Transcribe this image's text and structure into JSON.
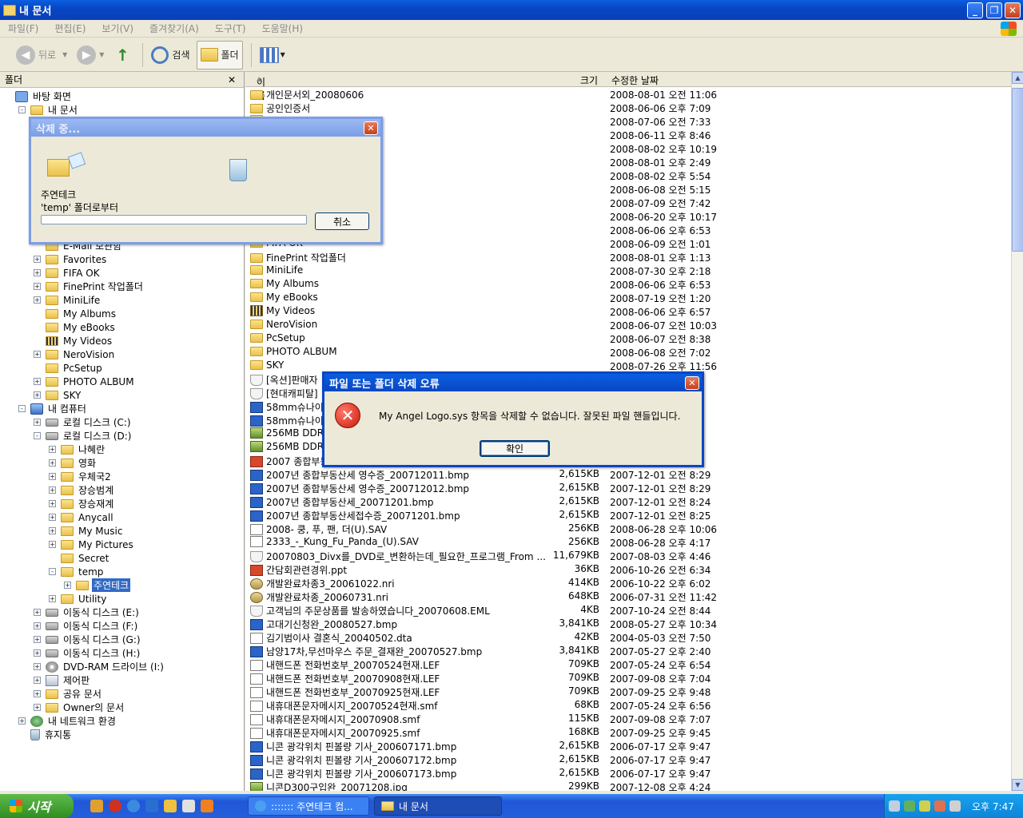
{
  "window": {
    "title": "내 문서"
  },
  "menu": [
    "파일(F)",
    "편집(E)",
    "보기(V)",
    "즐겨찾기(A)",
    "도구(T)",
    "도움말(H)"
  ],
  "toolbar": {
    "back": "뒤로",
    "search": "검색",
    "folders": "폴더"
  },
  "folder_pane": {
    "title": "폴더",
    "close": "✕"
  },
  "tree": [
    {
      "label": "바탕 화면",
      "level": 0,
      "exp": "",
      "icon": "desk"
    },
    {
      "label": "내 문서",
      "level": 1,
      "exp": "-",
      "icon": "mydocs"
    },
    {
      "label": "",
      "level": 2,
      "exp": "+",
      "icon": "folder"
    },
    {
      "label": "",
      "level": 2,
      "exp": "+",
      "icon": "folder"
    },
    {
      "label": "",
      "level": 2,
      "exp": "+",
      "icon": "folder"
    },
    {
      "label": "",
      "level": 2,
      "exp": "",
      "icon": "folder"
    },
    {
      "label": "",
      "level": 2,
      "exp": "+",
      "icon": "folder"
    },
    {
      "label": "",
      "level": 2,
      "exp": "+",
      "icon": "folder"
    },
    {
      "label": "",
      "level": 2,
      "exp": "",
      "icon": "folder"
    },
    {
      "label": "",
      "level": 2,
      "exp": "+",
      "icon": "folder"
    },
    {
      "label": "",
      "level": 2,
      "exp": "",
      "icon": "folder"
    },
    {
      "label": "E-Mail 보관함",
      "level": 2,
      "exp": "",
      "icon": "folder"
    },
    {
      "label": "Favorites",
      "level": 2,
      "exp": "+",
      "icon": "folder"
    },
    {
      "label": "FIFA OK",
      "level": 2,
      "exp": "+",
      "icon": "folder"
    },
    {
      "label": "FinePrint 작업폴더",
      "level": 2,
      "exp": "+",
      "icon": "folder"
    },
    {
      "label": "MiniLife",
      "level": 2,
      "exp": "+",
      "icon": "folder"
    },
    {
      "label": "My Albums",
      "level": 2,
      "exp": "",
      "icon": "folder"
    },
    {
      "label": "My eBooks",
      "level": 2,
      "exp": "",
      "icon": "folder"
    },
    {
      "label": "My Videos",
      "level": 2,
      "exp": "",
      "icon": "video"
    },
    {
      "label": "NeroVision",
      "level": 2,
      "exp": "+",
      "icon": "folder"
    },
    {
      "label": "PcSetup",
      "level": 2,
      "exp": "",
      "icon": "folder"
    },
    {
      "label": "PHOTO ALBUM",
      "level": 2,
      "exp": "+",
      "icon": "folder"
    },
    {
      "label": "SKY",
      "level": 2,
      "exp": "+",
      "icon": "folder"
    },
    {
      "label": "내 컴퓨터",
      "level": 1,
      "exp": "-",
      "icon": "pc"
    },
    {
      "label": "로컬 디스크 (C:)",
      "level": 2,
      "exp": "+",
      "icon": "drive"
    },
    {
      "label": "로컬 디스크 (D:)",
      "level": 2,
      "exp": "-",
      "icon": "drive"
    },
    {
      "label": "나혜란",
      "level": 3,
      "exp": "+",
      "icon": "folder"
    },
    {
      "label": "영화",
      "level": 3,
      "exp": "+",
      "icon": "folder"
    },
    {
      "label": "우체국2",
      "level": 3,
      "exp": "+",
      "icon": "folder"
    },
    {
      "label": "장승범계",
      "level": 3,
      "exp": "+",
      "icon": "folder"
    },
    {
      "label": "장승재계",
      "level": 3,
      "exp": "+",
      "icon": "folder"
    },
    {
      "label": "Anycall",
      "level": 3,
      "exp": "+",
      "icon": "folder"
    },
    {
      "label": "My Music",
      "level": 3,
      "exp": "+",
      "icon": "folder"
    },
    {
      "label": "My Pictures",
      "level": 3,
      "exp": "+",
      "icon": "folder"
    },
    {
      "label": "Secret",
      "level": 3,
      "exp": "",
      "icon": "folder"
    },
    {
      "label": "temp",
      "level": 3,
      "exp": "-",
      "icon": "folder"
    },
    {
      "label": "주연테크",
      "level": 4,
      "exp": "+",
      "icon": "folder",
      "selected": true
    },
    {
      "label": "Utility",
      "level": 3,
      "exp": "+",
      "icon": "folder"
    },
    {
      "label": "이동식 디스크 (E:)",
      "level": 2,
      "exp": "+",
      "icon": "drive"
    },
    {
      "label": "이동식 디스크 (F:)",
      "level": 2,
      "exp": "+",
      "icon": "drive"
    },
    {
      "label": "이동식 디스크 (G:)",
      "level": 2,
      "exp": "+",
      "icon": "drive"
    },
    {
      "label": "이동식 디스크 (H:)",
      "level": 2,
      "exp": "+",
      "icon": "drive"
    },
    {
      "label": "DVD-RAM 드라이브 (I:)",
      "level": 2,
      "exp": "+",
      "icon": "dvd"
    },
    {
      "label": "제어판",
      "level": 2,
      "exp": "+",
      "icon": "ctrl"
    },
    {
      "label": "공유 문서",
      "level": 2,
      "exp": "+",
      "icon": "folder"
    },
    {
      "label": "Owner의 문서",
      "level": 2,
      "exp": "+",
      "icon": "folder"
    },
    {
      "label": "내 네트워크 환경",
      "level": 1,
      "exp": "+",
      "icon": "net"
    },
    {
      "label": "휴지통",
      "level": 1,
      "exp": "",
      "icon": "bin"
    }
  ],
  "list_headers": {
    "name": "이름",
    "size": "크기",
    "date": "수정한 날짜"
  },
  "files": [
    {
      "name": "개인문서외_20080606",
      "size": "",
      "date": "2008-08-01 오전 11:06",
      "icon": "folder"
    },
    {
      "name": "공인인증서",
      "size": "",
      "date": "2008-06-06 오후 7:09",
      "icon": "folder"
    },
    {
      "name": "",
      "size": "",
      "date": "2008-07-06 오전 7:33",
      "icon": "folder"
    },
    {
      "name": "",
      "size": "",
      "date": "2008-06-11 오후 8:46",
      "icon": "folder"
    },
    {
      "name": "",
      "size": "",
      "date": "2008-08-02 오후 10:19",
      "icon": "folder"
    },
    {
      "name": "",
      "size": "",
      "date": "2008-08-01 오후 2:49",
      "icon": "folder"
    },
    {
      "name": "",
      "size": "",
      "date": "2008-08-02 오후 5:54",
      "icon": "folder"
    },
    {
      "name": "",
      "size": "",
      "date": "2008-06-08 오전 5:15",
      "icon": "folder"
    },
    {
      "name": "",
      "size": "",
      "date": "2008-07-09 오전 7:42",
      "icon": "folder"
    },
    {
      "name": "",
      "size": "",
      "date": "2008-06-20 오후 10:17",
      "icon": "folder"
    },
    {
      "name": "",
      "size": "",
      "date": "2008-06-06 오후 6:53",
      "icon": "folder"
    },
    {
      "name": "FIFA OK",
      "size": "",
      "date": "2008-06-09 오전 1:01",
      "icon": "folder"
    },
    {
      "name": "FinePrint 작업폴더",
      "size": "",
      "date": "2008-08-01 오후 1:13",
      "icon": "folder"
    },
    {
      "name": "MiniLife",
      "size": "",
      "date": "2008-07-30 오후 2:18",
      "icon": "folder"
    },
    {
      "name": "My Albums",
      "size": "",
      "date": "2008-06-06 오후 6:53",
      "icon": "folder"
    },
    {
      "name": "My eBooks",
      "size": "",
      "date": "2008-07-19 오전 1:20",
      "icon": "folder"
    },
    {
      "name": "My Videos",
      "size": "",
      "date": "2008-06-06 오후 6:57",
      "icon": "video"
    },
    {
      "name": "NeroVision",
      "size": "",
      "date": "2008-06-07 오전 10:03",
      "icon": "folder"
    },
    {
      "name": "PcSetup",
      "size": "",
      "date": "2008-06-07 오전 8:38",
      "icon": "folder"
    },
    {
      "name": "PHOTO ALBUM",
      "size": "",
      "date": "2008-06-08 오전 7:02",
      "icon": "folder"
    },
    {
      "name": "SKY",
      "size": "",
      "date": "2008-07-26 오후 11:56",
      "icon": "folder"
    },
    {
      "name": "[옥션]판매자",
      "size": "",
      "date": "",
      "icon": "eml"
    },
    {
      "name": "[현대캐피탈]",
      "size": "",
      "date": "",
      "icon": "eml"
    },
    {
      "name": "58mm슈나이더",
      "size": "",
      "date": "",
      "icon": "bmp"
    },
    {
      "name": "58mm슈나이더",
      "size": "",
      "date": "",
      "icon": "bmp"
    },
    {
      "name": "256MB DDR S",
      "size": "",
      "date": "",
      "icon": "jpg"
    },
    {
      "name": "256MB DDR S",
      "size": "",
      "date": "",
      "icon": "jpg"
    },
    {
      "name": "2007 종합부동",
      "size": "",
      "date": "",
      "icon": "ppt"
    },
    {
      "name": "2007년 종합부동산세 영수증_200712011.bmp",
      "size": "2,615KB",
      "date": "2007-12-01 오전 8:29",
      "icon": "bmp"
    },
    {
      "name": "2007년 종합부동산세 영수증_200712012.bmp",
      "size": "2,615KB",
      "date": "2007-12-01 오전 8:29",
      "icon": "bmp"
    },
    {
      "name": "2007년 종합부동산세_20071201.bmp",
      "size": "2,615KB",
      "date": "2007-12-01 오전 8:24",
      "icon": "bmp"
    },
    {
      "name": "2007년 종합부동산세접수증_20071201.bmp",
      "size": "2,615KB",
      "date": "2007-12-01 오전 8:25",
      "icon": "bmp"
    },
    {
      "name": "2008- 쿵, 푸, 팬, 더(U).SAV",
      "size": "256KB",
      "date": "2008-06-28 오후 10:06",
      "icon": "doc"
    },
    {
      "name": "2333_-_Kung_Fu_Panda_(U).SAV",
      "size": "256KB",
      "date": "2008-06-28 오후 4:17",
      "icon": "doc"
    },
    {
      "name": "20070803_Divx를_DVD로_변환하는데_필요한_프로그램_From ...",
      "size": "11,679KB",
      "date": "2007-08-03 오후 4:46",
      "icon": "eml"
    },
    {
      "name": "간담회관련경위.ppt",
      "size": "36KB",
      "date": "2006-10-26 오전 6:34",
      "icon": "ppt"
    },
    {
      "name": "개발완료차종3_20061022.nri",
      "size": "414KB",
      "date": "2006-10-22 오후 6:02",
      "icon": "nri"
    },
    {
      "name": "개발완료차종_20060731.nri",
      "size": "648KB",
      "date": "2006-07-31 오전 11:42",
      "icon": "nri"
    },
    {
      "name": "고객님의 주문상품를 발송하였습니다_20070608.EML",
      "size": "4KB",
      "date": "2007-10-24 오전 8:44",
      "icon": "eml"
    },
    {
      "name": "고대기신청완_20080527.bmp",
      "size": "3,841KB",
      "date": "2008-05-27 오후 10:34",
      "icon": "bmp"
    },
    {
      "name": "김기범이사 결혼식_20040502.dta",
      "size": "42KB",
      "date": "2004-05-03 오전 7:50",
      "icon": "doc"
    },
    {
      "name": "남양17차,무선마우스 주문_결재완_20070527.bmp",
      "size": "3,841KB",
      "date": "2007-05-27 오후 2:40",
      "icon": "bmp"
    },
    {
      "name": "내핸드폰 전화번호부_20070524현재.LEF",
      "size": "709KB",
      "date": "2007-05-24 오후 6:54",
      "icon": "doc"
    },
    {
      "name": "내핸드폰 전화번호부_20070908현재.LEF",
      "size": "709KB",
      "date": "2007-09-08 오후 7:04",
      "icon": "doc"
    },
    {
      "name": "내핸드폰 전화번호부_20070925현재.LEF",
      "size": "709KB",
      "date": "2007-09-25 오후 9:48",
      "icon": "doc"
    },
    {
      "name": "내휴대폰문자메시지_20070524현재.smf",
      "size": "68KB",
      "date": "2007-05-24 오후 6:56",
      "icon": "doc"
    },
    {
      "name": "내휴대폰문자메시지_20070908.smf",
      "size": "115KB",
      "date": "2007-09-08 오후 7:07",
      "icon": "doc"
    },
    {
      "name": "내휴대폰문자메시지_20070925.smf",
      "size": "168KB",
      "date": "2007-09-25 오후 9:45",
      "icon": "doc"
    },
    {
      "name": "니콘 광각위치 핀볼량 기사_200607171.bmp",
      "size": "2,615KB",
      "date": "2006-07-17 오후 9:47",
      "icon": "bmp"
    },
    {
      "name": "니콘 광각위치 핀볼량 기사_200607172.bmp",
      "size": "2,615KB",
      "date": "2006-07-17 오후 9:47",
      "icon": "bmp"
    },
    {
      "name": "니콘 광각위치 핀볼량 기사_200607173.bmp",
      "size": "2,615KB",
      "date": "2006-07-17 오후 9:47",
      "icon": "bmp"
    },
    {
      "name": "니콘D300구입완_20071208.jpg",
      "size": "299KB",
      "date": "2007-12-08 오후 4:24",
      "icon": "jpg"
    }
  ],
  "delete_dialog": {
    "title": "삭제 중...",
    "item": "주연테크",
    "from": "'temp' 폴더로부터",
    "cancel": "취소",
    "progress": 0
  },
  "error_dialog": {
    "title": "파일 또는 폴더 삭제 오류",
    "message": "My Angel Logo.sys 항목을 삭제할 수 없습니다. 잘못된 파일 핸들입니다.",
    "ok": "확인"
  },
  "taskbar": {
    "start": "시작",
    "tasks": [
      "::::::: 주연테크 컴...",
      "내 문서"
    ],
    "clock": "오후 7:47"
  }
}
